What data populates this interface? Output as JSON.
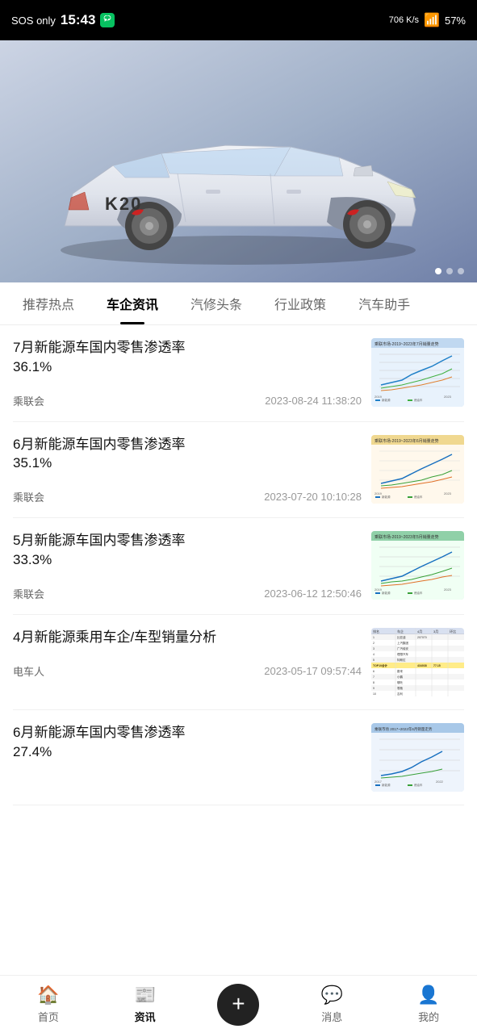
{
  "statusBar": {
    "sosText": "SOS only",
    "time": "15:43",
    "signal": "706 K/s",
    "wifiIcon": "wifi-icon",
    "batteryLevel": "57%"
  },
  "hero": {
    "carModel": "K20",
    "dots": [
      true,
      false,
      false
    ]
  },
  "navTabs": [
    {
      "label": "推荐热点",
      "active": false
    },
    {
      "label": "车企资讯",
      "active": true
    },
    {
      "label": "汽修头条",
      "active": false
    },
    {
      "label": "行业政策",
      "active": false
    },
    {
      "label": "汽车助手",
      "active": false
    }
  ],
  "newsList": [
    {
      "title": "7月新能源车国内零售渗透率\n36.1%",
      "source": "乘联会",
      "date": "2023-08-24 11:38:20",
      "thumbType": "chart1"
    },
    {
      "title": "6月新能源车国内零售渗透率\n35.1%",
      "source": "乘联会",
      "date": "2023-07-20 10:10:28",
      "thumbType": "chart2"
    },
    {
      "title": "5月新能源车国内零售渗透率\n33.3%",
      "source": "乘联会",
      "date": "2023-06-12 12:50:46",
      "thumbType": "chart3"
    },
    {
      "title": "4月新能源乘用车企/车型销量分析",
      "source": "电车人",
      "date": "2023-05-17 09:57:44",
      "thumbType": "table"
    },
    {
      "title": "6月新能源车国内零售渗透率\n27.4%",
      "source": "",
      "date": "",
      "thumbType": "chart5"
    }
  ],
  "bottomNav": [
    {
      "label": "首页",
      "active": false,
      "icon": "home-icon"
    },
    {
      "label": "资讯",
      "active": true,
      "icon": "news-icon"
    },
    {
      "label": "+",
      "active": false,
      "icon": "add-icon"
    },
    {
      "label": "消息",
      "active": false,
      "icon": "message-icon"
    },
    {
      "label": "我的",
      "active": false,
      "icon": "profile-icon"
    }
  ]
}
